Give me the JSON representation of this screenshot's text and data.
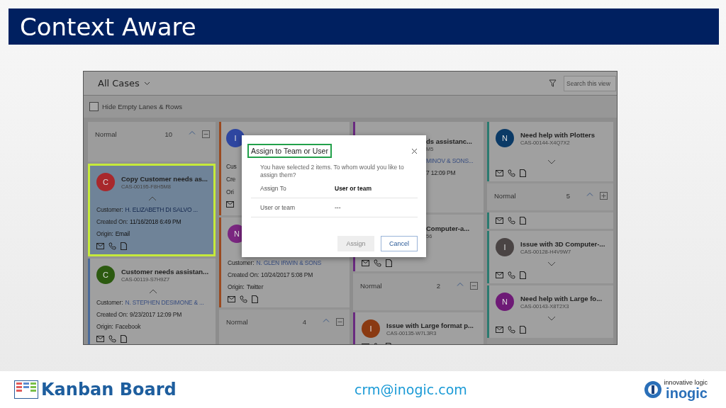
{
  "slide": {
    "title": "Context Aware"
  },
  "app": {
    "view_title": "All Cases",
    "search": {
      "placeholder": "Search this view"
    },
    "hide_empty": {
      "label": "Hide Empty Lanes & Rows",
      "checked": false
    }
  },
  "columns": [
    {
      "items": [
        {
          "kind": "lane",
          "label": "Normal",
          "count": "10",
          "expanded": true
        },
        {
          "kind": "full",
          "selected": true,
          "avatar": {
            "letter": "C",
            "color": "#a8282c"
          },
          "title": "Copy Customer needs as...",
          "case_id": "CAS-00195-F8H5M8",
          "expanded": true,
          "fields": [
            {
              "label": "Customer:",
              "value": "H. ELIZABETH DI SALVO ...",
              "link": true
            },
            {
              "label": "Created On:",
              "value": "11/16/2018 6:49 PM",
              "link": false
            },
            {
              "label": "Origin:",
              "value": "Email",
              "link": false
            }
          ]
        },
        {
          "kind": "full",
          "selected": false,
          "color": "#4a6a9a",
          "avatar": {
            "letter": "C",
            "color": "#2c5a10"
          },
          "title": "Customer needs assistan...",
          "case_id": "CAS-00119-S7H9Z7",
          "expanded": true,
          "fields": [
            {
              "label": "Customer:",
              "value": "N. STEPHEN DESIMONE & ...",
              "link": true
            },
            {
              "label": "Created On:",
              "value": "9/23/2017 12:09 PM",
              "link": false
            },
            {
              "label": "Origin:",
              "value": "Facebook",
              "link": false
            }
          ]
        }
      ]
    },
    {
      "items": [
        {
          "kind": "left",
          "selected": false,
          "color": "#9a4a20",
          "avatar": {
            "letter": "I",
            "color": "#2e46a0"
          },
          "fields": [
            {
              "label": "Cus"
            },
            {
              "label": "Cre"
            },
            {
              "label": "Ori"
            }
          ]
        },
        {
          "kind": "full",
          "selected": false,
          "color": "#9a4a20",
          "avatar": {
            "letter": "N",
            "color": "#7a2680"
          },
          "fields": [
            {
              "label": "Customer:",
              "value": "N. GLEN IRWIN & SONS",
              "link": true
            },
            {
              "label": "Created On:",
              "value": "10/24/2017 5:08 PM",
              "link": false
            },
            {
              "label": "Origin:",
              "value": "Twitter",
              "link": false
            }
          ]
        },
        {
          "kind": "lane",
          "label": "Normal",
          "count": "4",
          "expanded": true
        }
      ]
    },
    {
      "items": [
        {
          "kind": "right",
          "selected": false,
          "color": "#6a2a80",
          "title": "ds assistanc...",
          "case_id": "M5",
          "fields": [
            {
              "value": "MINOV & SONS...",
              "link": true
            },
            {
              "value": "7 12:09 PM",
              "link": false
            }
          ]
        },
        {
          "kind": "right-icons",
          "selected": false,
          "color": "#6a2a80",
          "title": "Computer-a...",
          "case_id": "56"
        },
        {
          "kind": "lane",
          "label": "Normal",
          "count": "2",
          "expanded": true
        },
        {
          "kind": "full",
          "selected": false,
          "color": "#6a2a80",
          "avatar": {
            "letter": "I",
            "color": "#8a3a12"
          },
          "title": "Issue with Large format p...",
          "case_id": "CAS-00135-W7L3R3"
        }
      ]
    },
    {
      "items": [
        {
          "kind": "full",
          "selected": false,
          "color": "#2a7a70",
          "avatar": {
            "letter": "N",
            "color": "#0b3a66"
          },
          "title": "Need help with Plotters",
          "case_id": "CAS-00144-X4Q7X2",
          "expanded": false
        },
        {
          "kind": "lane",
          "label": "Normal",
          "count": "5",
          "expanded": false
        },
        {
          "kind": "icons",
          "selected": false,
          "color": "#2a7a70"
        },
        {
          "kind": "full",
          "selected": false,
          "color": "#2a7a70",
          "avatar": {
            "letter": "I",
            "color": "#4a4444"
          },
          "title": "Issue with 3D Computer-...",
          "case_id": "CAS-00128-H4V9W7",
          "expanded": false
        },
        {
          "kind": "full",
          "selected": false,
          "color": "#2a7a70",
          "avatar": {
            "letter": "N",
            "color": "#6e1a76"
          },
          "title": "Need help with Large fo...",
          "case_id": "CAS-00143-X8T2X3",
          "expanded": false
        }
      ]
    }
  ],
  "dialog": {
    "title": "Assign to Team or User",
    "title_highlighted": true,
    "message": "You have selected 2 items. To whom would you like to assign them?",
    "rows": [
      {
        "kind": "select",
        "label": "Assign To",
        "value": "User or team"
      },
      {
        "kind": "lookup",
        "label": "User or team",
        "value": "---"
      }
    ],
    "buttons": [
      {
        "label": "Assign",
        "disabled": true
      },
      {
        "label": "Cancel",
        "disabled": false
      }
    ]
  },
  "footer": {
    "product": "Kanban Board",
    "email": "crm@inogic.com",
    "logo_tagline": "innovative logic",
    "logo_name": "inogic"
  }
}
